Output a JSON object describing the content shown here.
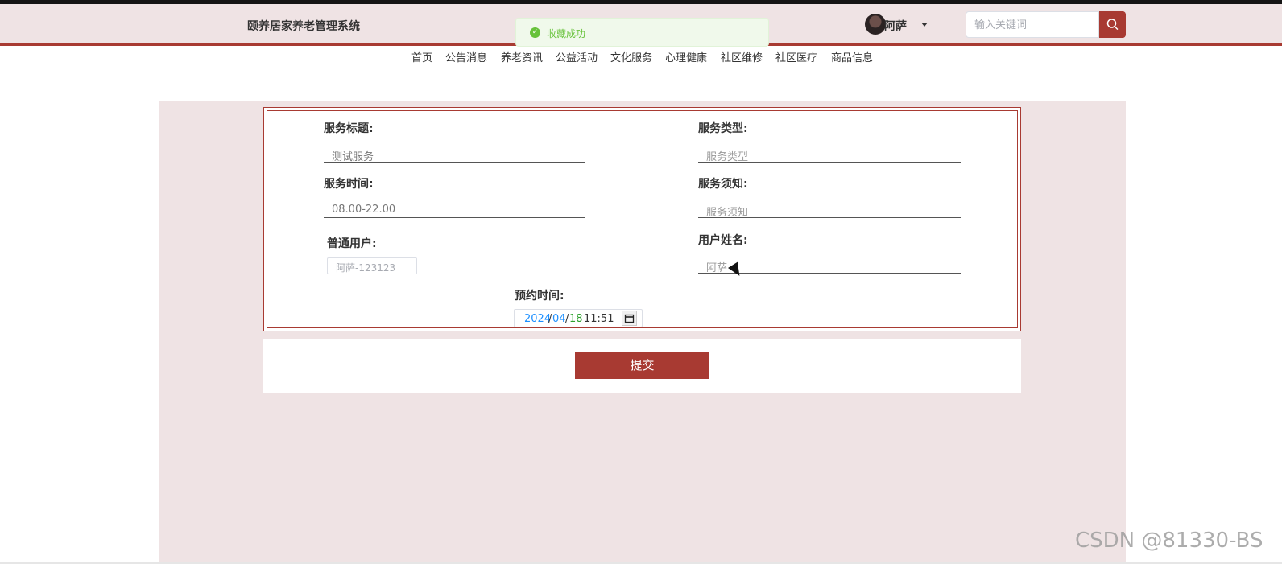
{
  "app": {
    "title": "颐养居家养老管理系统"
  },
  "toast": {
    "message": "收藏成功",
    "icon": "check-circle-icon",
    "color": "#67c23a"
  },
  "user": {
    "name": "阿萨",
    "avatar_icon": "user-avatar-icon",
    "dropdown_icon": "caret-down-icon"
  },
  "search": {
    "placeholder": "输入关键词",
    "icon": "search-icon"
  },
  "nav": [
    "首页",
    "公告消息",
    "养老资讯",
    "公益活动",
    "文化服务",
    "心理健康",
    "社区维修",
    "社区医疗",
    "商品信息"
  ],
  "form": {
    "title_label": "服务标题:",
    "title_value": "测试服务",
    "type_label": "服务类型:",
    "type_placeholder": "服务类型",
    "time_label": "服务时间:",
    "time_value": "08.00-22.00",
    "notice_label": "服务须知:",
    "notice_placeholder": "服务须知",
    "account_label": "普通用户:",
    "account_value": "阿萨-123123",
    "username_label": "用户姓名:",
    "username_value": "阿萨",
    "reserve_label": "预约时间:",
    "reserve_date": {
      "year": "2024",
      "sep": "/",
      "month": "04",
      "day": "18",
      "time": "11:51"
    },
    "calendar_icon": "calendar-icon"
  },
  "submit_label": "提交",
  "colors": {
    "brand": "#a83a32",
    "header_bg": "#efe3e4",
    "success": "#67c23a"
  },
  "watermark": "CSDN @81330-BS"
}
